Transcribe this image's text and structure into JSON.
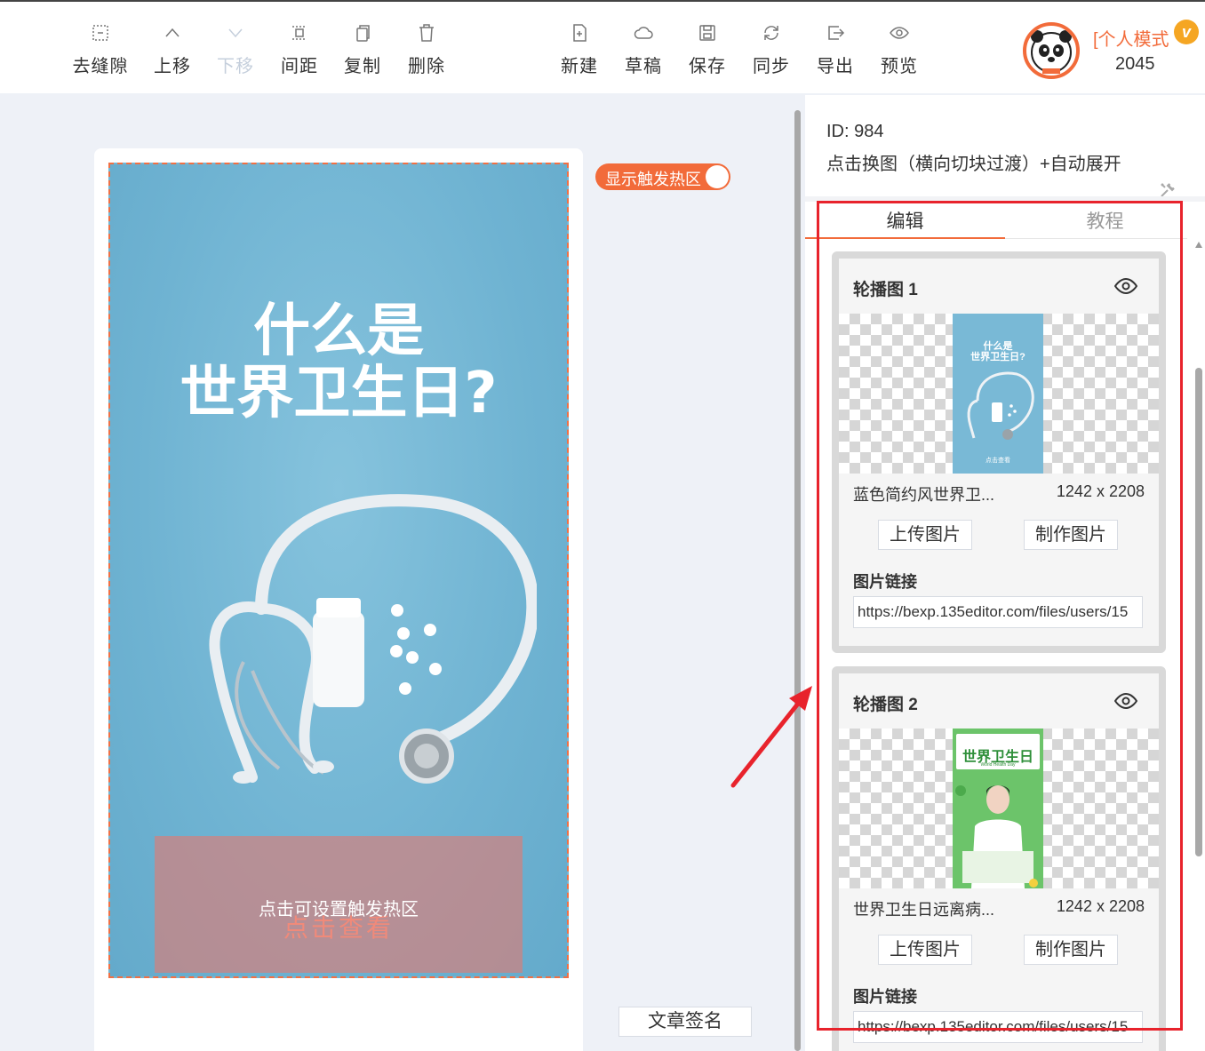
{
  "toolbar": {
    "left_tools": [
      {
        "label": "去缝隙",
        "icon": "gap-icon"
      },
      {
        "label": "上移",
        "icon": "chevron-up-icon"
      },
      {
        "label": "下移",
        "icon": "chevron-down-icon",
        "disabled": true
      },
      {
        "label": "间距",
        "icon": "spacing-icon"
      },
      {
        "label": "复制",
        "icon": "copy-icon"
      },
      {
        "label": "删除",
        "icon": "trash-icon"
      }
    ],
    "right_tools": [
      {
        "label": "新建",
        "icon": "new-file-icon"
      },
      {
        "label": "草稿",
        "icon": "cloud-icon"
      },
      {
        "label": "保存",
        "icon": "save-icon"
      },
      {
        "label": "同步",
        "icon": "sync-icon"
      },
      {
        "label": "导出",
        "icon": "export-icon"
      },
      {
        "label": "预览",
        "icon": "eye-icon"
      }
    ]
  },
  "user": {
    "mode_text": "[个人模式",
    "vip_badge": "v",
    "number": "2045"
  },
  "canvas": {
    "poster_title_line1": "什么是",
    "poster_title_line2": "世界卫生日?",
    "hotzone_caption": "点击可设置触发热区",
    "hotzone_subtext": "点击查看",
    "toggle_label": "显示触发热区",
    "toggle_on": true,
    "signature_button": "文章签名"
  },
  "panel": {
    "id_text": "ID: 984",
    "description": "点击换图（横向切块过渡）+自动展开",
    "tabs": [
      {
        "label": "编辑",
        "active": true
      },
      {
        "label": "教程",
        "active": false
      }
    ],
    "slides": [
      {
        "title": "轮播图 1",
        "name": "蓝色简约风世界卫...",
        "size": "1242 x 2208",
        "upload_label": "上传图片",
        "make_label": "制作图片",
        "link_label": "图片链接",
        "link_value": "https://bexp.135editor.com/files/users/15",
        "thumb_title1": "什么是",
        "thumb_title2": "世界卫生日?",
        "thumb_footer": "点击查看"
      },
      {
        "title": "轮播图 2",
        "name": "世界卫生日远离病...",
        "size": "1242 x 2208",
        "upload_label": "上传图片",
        "make_label": "制作图片",
        "link_label": "图片链接",
        "link_value": "https://bexp.135editor.com/files/users/15",
        "thumb_title1": "世界卫生日",
        "thumb_subtitle": "World Health Day"
      }
    ]
  },
  "colors": {
    "accent": "#f26b3a",
    "highlight_box": "#e8232c",
    "poster_blue": "#72b6d4",
    "thumb_green": "#5cb85c"
  }
}
